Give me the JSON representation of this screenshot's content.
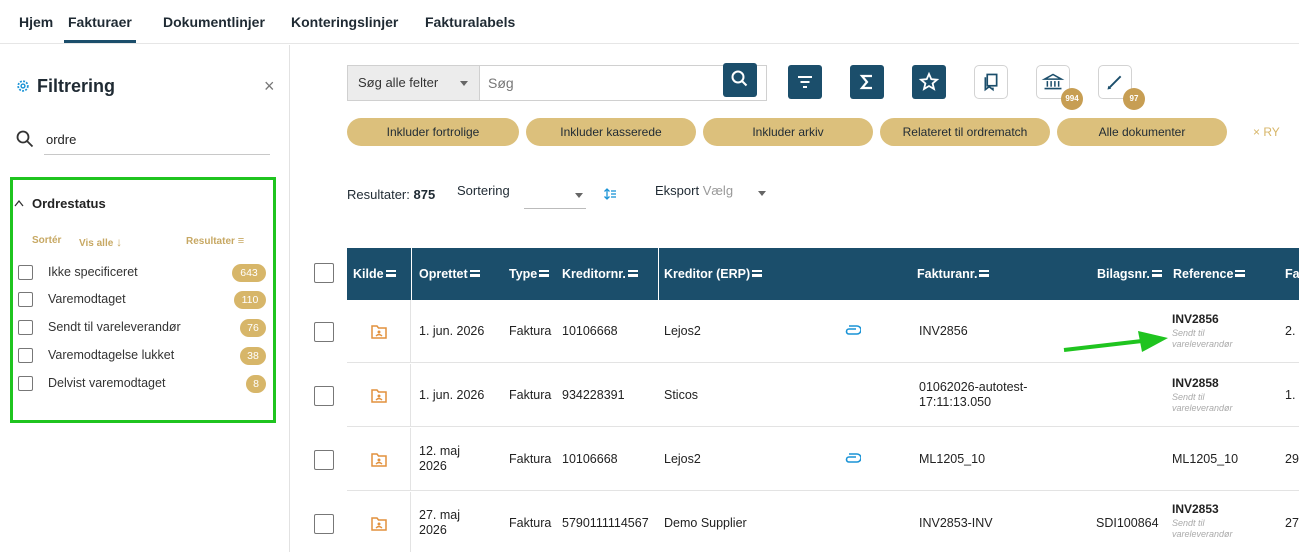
{
  "nav": {
    "tabs": [
      "Hjem",
      "Fakturaer",
      "Dokumentlinjer",
      "Konteringslinjer",
      "Fakturalabels"
    ],
    "active": "Fakturaer"
  },
  "sidebar": {
    "title": "Filtrering",
    "close_icon": "close-icon",
    "search_value": "ordre",
    "section_title": "Ordrestatus",
    "sort_label": "Sortér",
    "show_all_label": "Vis alle",
    "results_label": "Resultater",
    "statuses": [
      {
        "label": "Ikke specificeret",
        "count": "643"
      },
      {
        "label": "Varemodtaget",
        "count": "110"
      },
      {
        "label": "Sendt til vareleverandør",
        "count": "76"
      },
      {
        "label": "Varemodtagelse lukket",
        "count": "38"
      },
      {
        "label": "Delvist varemodtaget",
        "count": "8"
      }
    ]
  },
  "toolbar": {
    "search_scope": "Søg alle felter",
    "search_placeholder": "Søg",
    "icons": [
      "search-icon",
      "filter-icon",
      "sum-icon",
      "star-icon",
      "bookmark-icon",
      "bank-icon",
      "edit-icon"
    ],
    "bank_badge": "994",
    "edit_badge": "97"
  },
  "chips": [
    "Inkluder fortrolige",
    "Inkluder kasserede",
    "Inkluder arkiv",
    "Relateret til ordrematch",
    "Alle dokumenter"
  ],
  "chip_clear": "× RY",
  "results": {
    "label": "Resultater:",
    "count": "875",
    "sorting_label": "Sortering",
    "export_label": "Eksport",
    "export_placeholder": "Vælg"
  },
  "table": {
    "columns": [
      "Kilde",
      "Oprettet",
      "Type",
      "Kreditornr.",
      "Kreditor (ERP)",
      "Fakturanr.",
      "Bilagsnr.",
      "Reference",
      "Fa"
    ],
    "rows": [
      {
        "created": "1. jun. 2026",
        "type": "Faktura",
        "creditor_no": "10106668",
        "creditor": "Lejos2",
        "attachment": true,
        "invoice_no": "INV2856",
        "voucher_no": "",
        "reference": "INV2856",
        "ref_status": "Sendt til vareleverandør",
        "fa": "2."
      },
      {
        "created": "1. jun. 2026",
        "type": "Faktura",
        "creditor_no": "934228391",
        "creditor": "Sticos",
        "attachment": false,
        "invoice_no": "01062026-autotest-17:11:13.050",
        "voucher_no": "",
        "reference": "INV2858",
        "ref_status": "Sendt til vareleverandør",
        "fa": "1."
      },
      {
        "created": "12. maj 2026",
        "type": "Faktura",
        "creditor_no": "10106668",
        "creditor": "Lejos2",
        "attachment": true,
        "invoice_no": "ML1205_10",
        "voucher_no": "",
        "reference": "ML1205_10",
        "ref_status": "",
        "fa": "29"
      },
      {
        "created": "27. maj 2026",
        "type": "Faktura",
        "creditor_no": "5790111114567",
        "creditor": "Demo Supplier",
        "attachment": false,
        "invoice_no": "INV2853-INV",
        "voucher_no": "SDI100864",
        "reference": "INV2853",
        "ref_status": "Sendt til vareleverandør",
        "fa": "27"
      }
    ]
  },
  "colors": {
    "primary": "#1b4e6b",
    "gold": "#d7b669",
    "highlight": "#1fc41f",
    "attachment": "#1a93d6",
    "folder": "#e2913d"
  }
}
